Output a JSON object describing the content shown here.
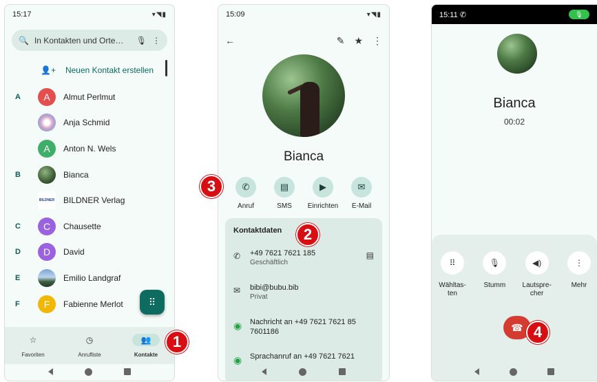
{
  "phone1": {
    "status_time": "15:17",
    "status_icons": "▾◥▮",
    "search_placeholder": "In Kontakten und Orte…",
    "new_contact": "Neuen Kontakt erstellen",
    "contacts": [
      {
        "letter": "A",
        "name": "Almut Perlmut",
        "initial": "A",
        "color": "#e34f4f"
      },
      {
        "letter": "",
        "name": "Anja Schmid",
        "initial": "",
        "color": "#8aa0d8"
      },
      {
        "letter": "",
        "name": "Anton N. Wels",
        "initial": "A",
        "color": "#3fae6a"
      },
      {
        "letter": "B",
        "name": "Bianca",
        "initial": "",
        "color": "#3b5b35"
      },
      {
        "letter": "",
        "name": "BILDNER Verlag",
        "initial": "",
        "color": "#ffffff"
      },
      {
        "letter": "C",
        "name": "Chausette",
        "initial": "C",
        "color": "#9b62e0"
      },
      {
        "letter": "D",
        "name": "David",
        "initial": "D",
        "color": "#9b62e0"
      },
      {
        "letter": "E",
        "name": "Emilio Landgraf",
        "initial": "",
        "color": "#5b7fae"
      },
      {
        "letter": "F",
        "name": "Fabienne Merlot",
        "initial": "F",
        "color": "#f2b705"
      }
    ],
    "nav": [
      {
        "label": "Favoriten",
        "icon": "☆"
      },
      {
        "label": "Anrufliste",
        "icon": "◷"
      },
      {
        "label": "Kontakte",
        "icon": "👥"
      }
    ],
    "badge": "1"
  },
  "phone2": {
    "status_time": "15:09",
    "status_icons": "▾◥▮",
    "name": "Bianca",
    "actions": [
      {
        "label": "Anruf",
        "icon": "✆"
      },
      {
        "label": "SMS",
        "icon": "▤"
      },
      {
        "label": "Einrichten",
        "icon": "▶"
      },
      {
        "label": "E-Mail",
        "icon": "✉"
      }
    ],
    "card_title": "Kontaktdaten",
    "details": [
      {
        "icon": "✆",
        "line1": "+49 7621 7621 185",
        "line2": "Geschäftlich",
        "trail": "▤",
        "wa": false
      },
      {
        "icon": "✉",
        "line1": "bibi@bubu.bib",
        "line2": "Privat",
        "trail": "",
        "wa": false
      },
      {
        "icon": "◉",
        "line1": "Nachricht an +49 7621 7621 85",
        "line2": "7601186",
        "trail": "",
        "wa": true
      },
      {
        "icon": "◉",
        "line1": "Sprachanruf an +49 7621 7621",
        "line2": "",
        "trail": "",
        "wa": true
      }
    ],
    "badge_card": "2",
    "badge_call": "3"
  },
  "phone3": {
    "status_time": "15:11",
    "name": "Bianca",
    "timer": "00:02",
    "buttons": [
      {
        "label": "Wähltas-ten",
        "icon": "⠿"
      },
      {
        "label": "Stumm",
        "icon": "🎙"
      },
      {
        "label": "Lautspre-cher",
        "icon": "◀)"
      },
      {
        "label": "Mehr",
        "icon": "⋮"
      }
    ],
    "badge": "4"
  }
}
